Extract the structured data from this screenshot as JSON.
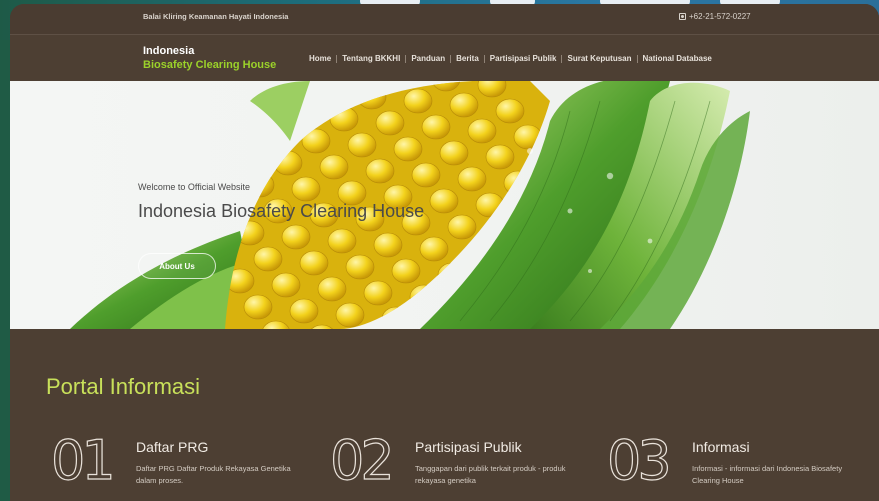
{
  "topbar": {
    "org_name": "Balai Kliring Keamanan Hayati Indonesia",
    "phone": "+62-21-572-0227",
    "phone_icon": "phone-icon"
  },
  "logo": {
    "line1": "Indonesia",
    "line2": "Biosafety Clearing House"
  },
  "nav": {
    "items": [
      {
        "label": "Home"
      },
      {
        "label": "Tentang BKKHI"
      },
      {
        "label": "Panduan"
      },
      {
        "label": "Berita"
      },
      {
        "label": "Partisipasi Publik"
      },
      {
        "label": "Surat Keputusan"
      },
      {
        "label": "National Database"
      }
    ]
  },
  "hero": {
    "welcome": "Welcome to Official Website",
    "title": "Indonesia Biosafety Clearing House",
    "button": "About Us"
  },
  "portal": {
    "title": "Portal Informasi",
    "cards": [
      {
        "number": "01",
        "title": "Daftar PRG",
        "desc": "Daftar PRG Daftar Produk Rekayasa Genetika dalam proses."
      },
      {
        "number": "02",
        "title": "Partisipasi Publik",
        "desc": "Tanggapan dari publik terkait produk - produk rekayasa genetika"
      },
      {
        "number": "03",
        "title": "Informasi",
        "desc": "Informasi - informasi dari Indonesia Biosafety Clearing House"
      }
    ]
  },
  "colors": {
    "brand_green": "#9bd22a",
    "portal_title": "#c8e05a",
    "background": "#4d3f33"
  }
}
